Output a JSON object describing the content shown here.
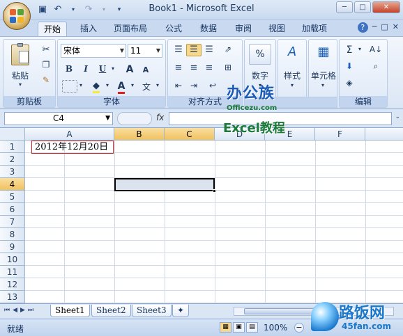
{
  "window": {
    "title": "Book1 - Microsoft Excel",
    "min": "─",
    "max": "□",
    "close": "✕"
  },
  "qat": {
    "save_icon": "save-icon",
    "undo_icon": "undo-icon",
    "redo_icon": "redo-icon",
    "custom_icon": "customize-icon"
  },
  "tabs": [
    "开始",
    "插入",
    "页面布局",
    "公式",
    "数据",
    "审阅",
    "视图",
    "加载项"
  ],
  "help_controls": [
    "?",
    "─",
    "□",
    "✕"
  ],
  "ribbon": {
    "clipboard": {
      "label": "剪贴板",
      "paste": "粘贴"
    },
    "font": {
      "label": "字体",
      "name": "宋体",
      "size": "11",
      "bold": "B",
      "italic": "I",
      "underline": "U",
      "grow": "A",
      "shrink": "A",
      "wen": "文",
      "color_a": "A"
    },
    "align": {
      "label": "对齐方式"
    },
    "number": {
      "label": "数字",
      "pct": "%"
    },
    "style": {
      "label": "样式"
    },
    "cells": {
      "label": "单元格"
    },
    "edit": {
      "label": "编辑",
      "sigma": "Σ"
    }
  },
  "formula_bar": {
    "name_box": "C4",
    "fx": "fx",
    "value": ""
  },
  "columns": [
    "A",
    "B",
    "C",
    "D",
    "E",
    "F"
  ],
  "rows": [
    "1",
    "2",
    "3",
    "4",
    "5",
    "6",
    "7",
    "8",
    "9",
    "10",
    "11",
    "12",
    "13"
  ],
  "cell_a1": "2012年12月20日",
  "sheets": [
    "Sheet1",
    "Sheet2",
    "Sheet3"
  ],
  "status": {
    "ready": "就绪",
    "zoom": "100%"
  },
  "watermarks": {
    "w1": "办公族",
    "w2": "Officezu.com",
    "w3": "Excel教程",
    "w4a": "路饭网",
    "w4b": "45fan.com"
  }
}
